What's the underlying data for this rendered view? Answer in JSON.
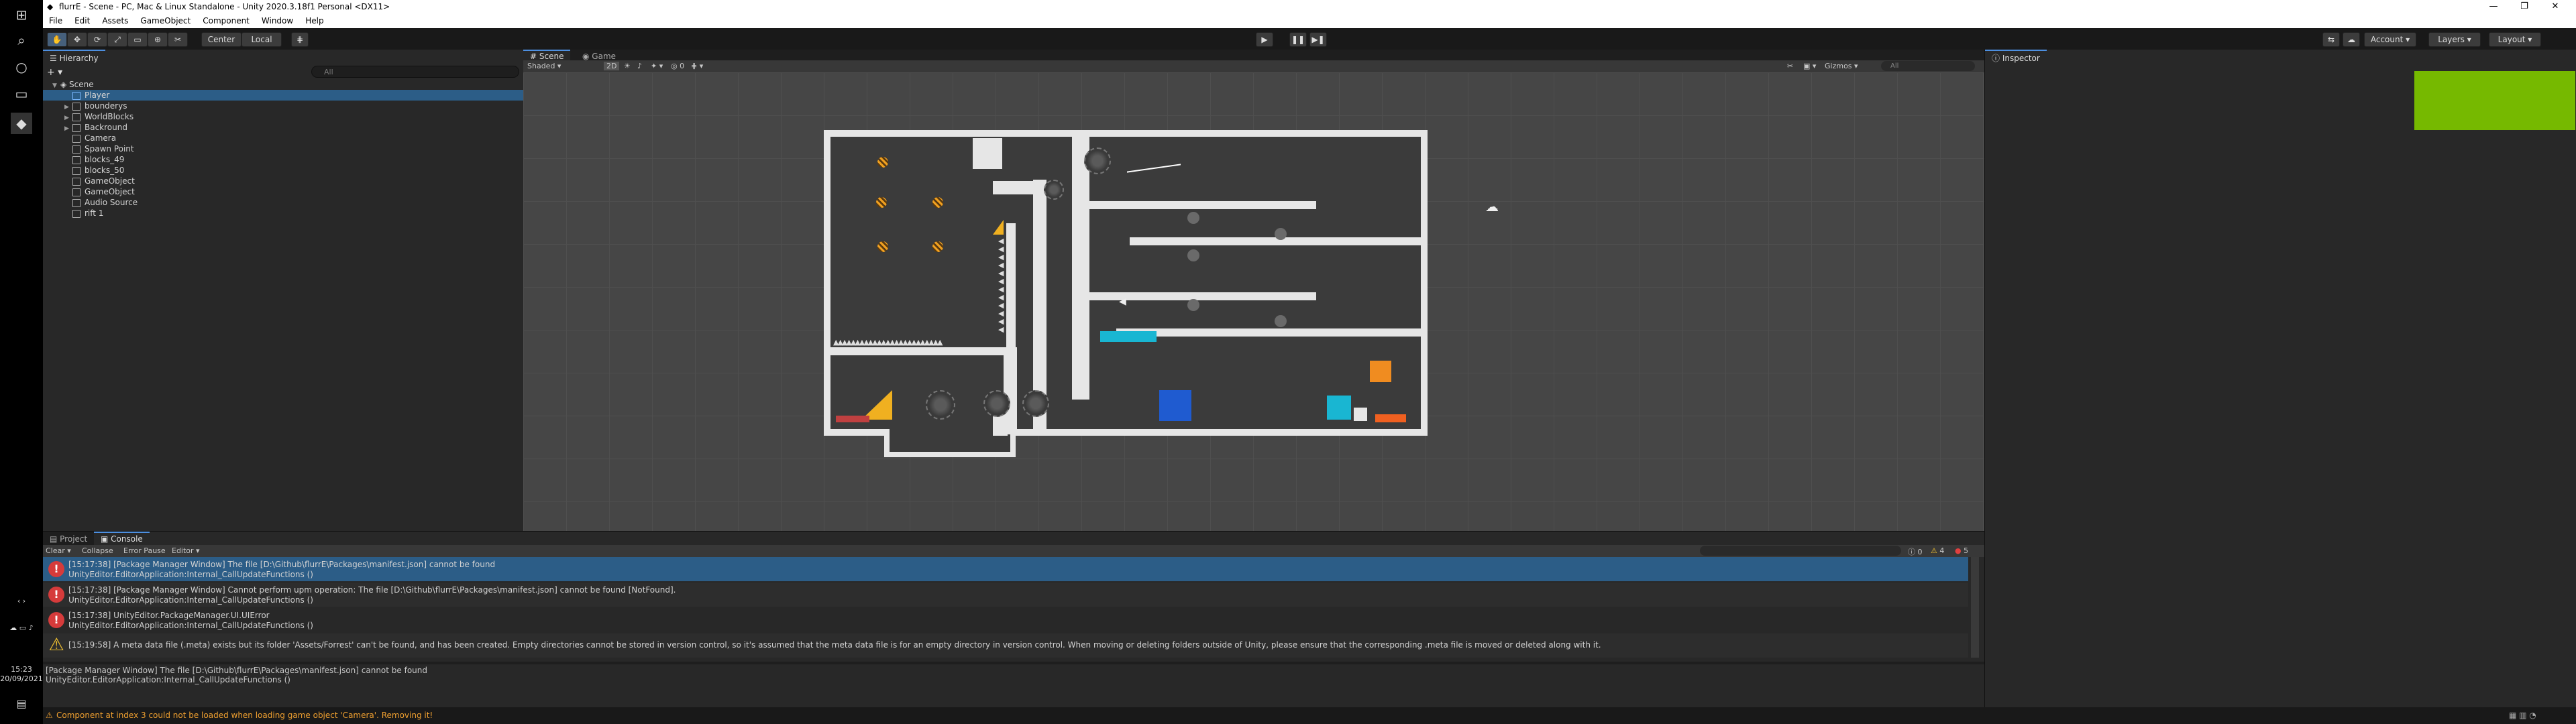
{
  "window": {
    "title": "flurrE - Scene - PC, Mac & Linux Standalone - Unity 2020.3.18f1 Personal <DX11>"
  },
  "menu": [
    "File",
    "Edit",
    "Assets",
    "GameObject",
    "Component",
    "Window",
    "Help"
  ],
  "toolbar": {
    "pivot_label": "Center",
    "space_label": "Local",
    "account_label": "Account",
    "layers_label": "Layers",
    "layout_label": "Layout"
  },
  "hierarchy": {
    "tab_label": "Hierarchy",
    "search_placeholder": "All",
    "scene_name": "Scene",
    "items": [
      "Player",
      "bounderys",
      "WorldBlocks",
      "Backround",
      "Camera",
      "Spawn Point",
      "blocks_49",
      "blocks_50",
      "GameObject",
      "GameObject",
      "Audio Source",
      "rift 1"
    ]
  },
  "scene": {
    "tab_scene": "Scene",
    "tab_game": "Game",
    "shading_mode": "Shaded",
    "mode_2d": "2D",
    "gizmos_label": "Gizmos",
    "search_placeholder": "All"
  },
  "inspector": {
    "tab_label": "Inspector",
    "accent_color": "#76b900"
  },
  "console": {
    "tab_project": "Project",
    "tab_console": "Console",
    "clear": "Clear",
    "collapse": "Collapse",
    "error_pause": "Error Pause",
    "editor": "Editor",
    "count_info": "0",
    "count_warn": "4",
    "count_error": "5",
    "entries": [
      {
        "type": "error",
        "line1": "[15:17:38] [Package Manager Window] The file [D:\\Github\\flurrE\\Packages\\manifest.json] cannot be found",
        "line2": "UnityEditor.EditorApplication:Internal_CallUpdateFunctions ()",
        "selected": true
      },
      {
        "type": "error",
        "line1": "[15:17:38] [Package Manager Window] Cannot perform upm operation: The file [D:\\Github\\flurrE\\Packages\\manifest.json] cannot be found [NotFound].",
        "line2": "UnityEditor.EditorApplication:Internal_CallUpdateFunctions ()",
        "selected": false
      },
      {
        "type": "error",
        "line1": "[15:17:38] UnityEditor.PackageManager.UI.UIError",
        "line2": "UnityEditor.EditorApplication:Internal_CallUpdateFunctions ()",
        "selected": false
      },
      {
        "type": "warn",
        "line1": "[15:19:58] A meta data file (.meta) exists but its folder 'Assets/Forrest' can't be found, and has been created. Empty directories cannot be stored in version control, so it's assumed that the meta data file is for an empty directory in version control. When moving or deleting folders outside of Unity, please ensure that the corresponding .meta file is moved or deleted along with it.",
        "line2": "",
        "selected": false
      }
    ],
    "detail_line1": "[Package Manager Window] The file [D:\\Github\\flurrE\\Packages\\manifest.json] cannot be found",
    "detail_line2": "UnityEditor.EditorApplication:Internal_CallUpdateFunctions ()"
  },
  "status": {
    "message": "Component at index 3 could not be loaded when loading game object 'Camera'. Removing it!"
  },
  "taskbar": {
    "time": "15:23",
    "date": "20/09/2021"
  }
}
